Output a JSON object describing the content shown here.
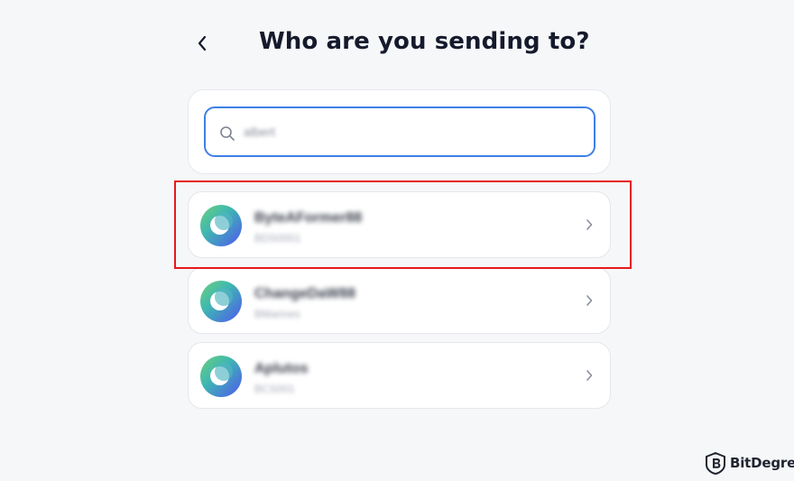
{
  "header": {
    "title": "Who are you sending to?",
    "back_icon": "chevron-left-icon"
  },
  "search": {
    "value": "albert",
    "icon": "search-icon"
  },
  "recipients": [
    {
      "name": "ByteAFormer88",
      "subtitle": "BDS0001",
      "avatar": "crescent-avatar"
    },
    {
      "name": "ChangeDaW88",
      "subtitle": "BMarines",
      "avatar": "crescent-avatar"
    },
    {
      "name": "Aplutos",
      "subtitle": "BCS001",
      "avatar": "crescent-avatar"
    }
  ],
  "highlight": {
    "color": "#e6191e"
  },
  "brand": {
    "name": "BitDegree"
  },
  "colors": {
    "accent": "#3f7fe6",
    "background": "#f6f7f9",
    "title": "#151a2c"
  }
}
